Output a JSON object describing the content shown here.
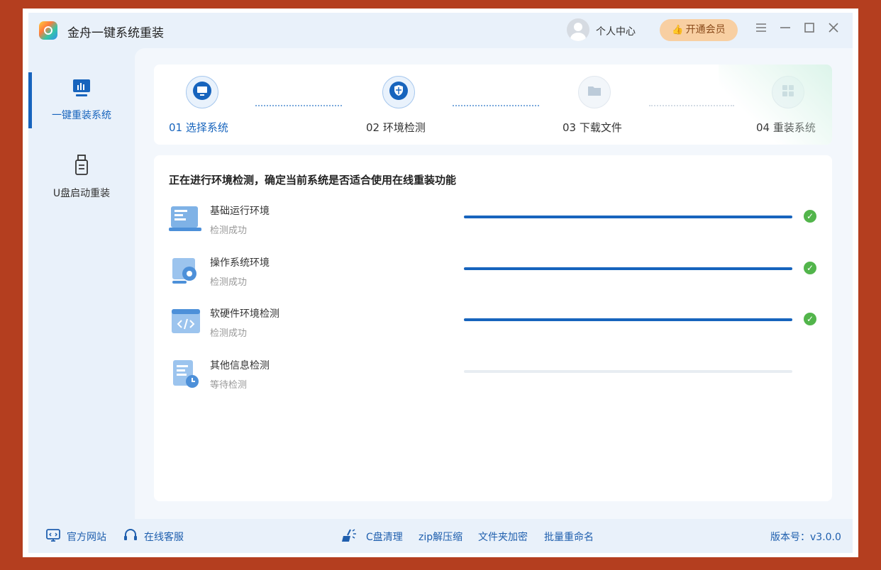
{
  "app": {
    "title": "金舟一键系统重装"
  },
  "header": {
    "user_center": "个人中心",
    "vip_button": "开通会员",
    "menu_icon": "hamburger-icon",
    "minimize_icon": "minimize-icon",
    "maximize_icon": "maximize-icon",
    "close_icon": "close-icon"
  },
  "sidebar": {
    "items": [
      {
        "label": "一键重装系统",
        "icon": "monitor-chart-icon",
        "active": true
      },
      {
        "label": "U盘启动重装",
        "icon": "usb-drive-icon",
        "active": false
      }
    ]
  },
  "steps": [
    {
      "label": "01 选择系统",
      "icon": "monitor-icon",
      "state": "done"
    },
    {
      "label": "02 环境检测",
      "icon": "shield-icon",
      "state": "current"
    },
    {
      "label": "03 下载文件",
      "icon": "folder-icon",
      "state": "pending"
    },
    {
      "label": "04 重装系统",
      "icon": "windows-icon",
      "state": "pending"
    }
  ],
  "main": {
    "headline": "正在进行环境检测，确定当前系统是否适合使用在线重装功能",
    "checks": [
      {
        "name": "基础运行环境",
        "status": "检测成功",
        "progress": 1.0,
        "done": true
      },
      {
        "name": "操作系统环境",
        "status": "检测成功",
        "progress": 1.0,
        "done": true
      },
      {
        "name": "软硬件环境检测",
        "status": "检测成功",
        "progress": 1.0,
        "done": true
      },
      {
        "name": "其他信息检测",
        "status": "等待检测",
        "progress": 0.0,
        "done": false
      }
    ]
  },
  "footer": {
    "official_site": "官方网站",
    "online_service": "在线客服",
    "c_clean": "C盘清理",
    "zip": "zip解压缩",
    "folder_encrypt": "文件夹加密",
    "batch_rename": "批量重命名",
    "version": "版本号：v3.0.0"
  },
  "colors": {
    "accent": "#1764bd",
    "success": "#52b54b",
    "background": "#b43e1f",
    "vip": "#f8cfa2"
  }
}
